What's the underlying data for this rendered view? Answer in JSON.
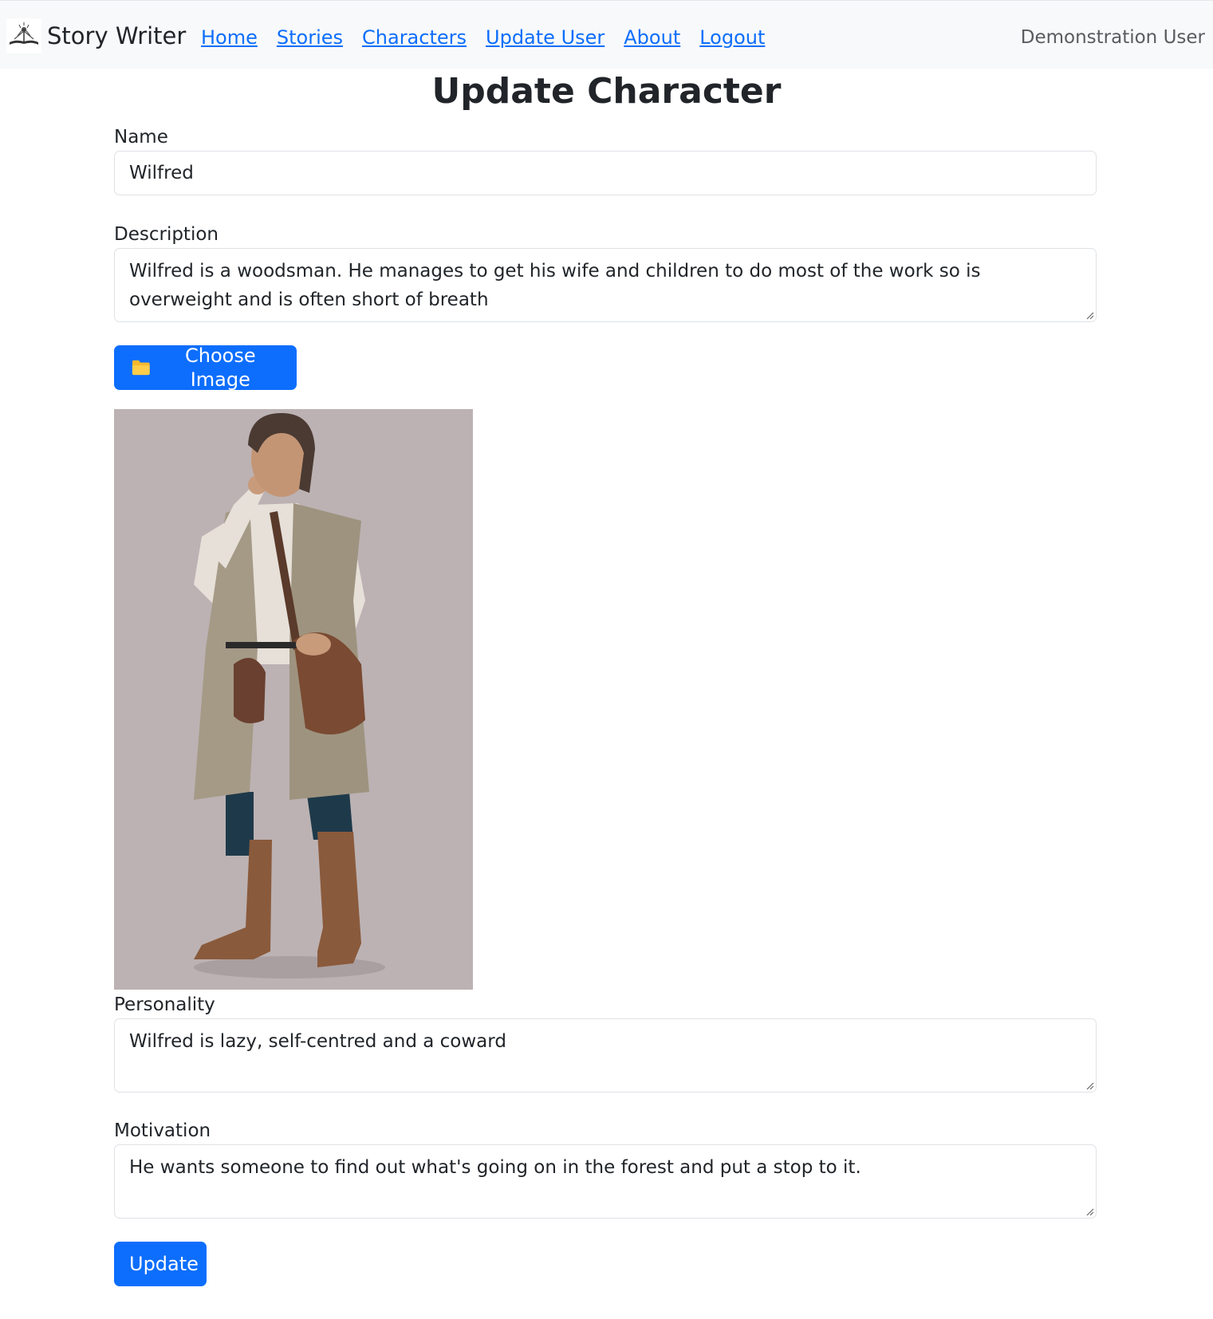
{
  "nav": {
    "brand": "Story Writer",
    "links": [
      "Home",
      "Stories",
      "Characters",
      "Update User",
      "About",
      "Logout"
    ],
    "user": "Demonstration User"
  },
  "page": {
    "title": "Update Character"
  },
  "form": {
    "name_label": "Name",
    "name_value": "Wilfred",
    "description_label": "Description",
    "description_value": "Wilfred is a woodsman. He manages to get his wife and children to do most of the work so is overweight and is often short of breath",
    "choose_image_label": "Choose Image",
    "choose_image_icon": "folder-icon",
    "personality_label": "Personality",
    "personality_value": "Wilfred is lazy, self-centred and a coward",
    "motivation_label": "Motivation",
    "motivation_value": "He wants someone to find out what's going on in the forest and put a stop to it.",
    "update_label": "Update"
  },
  "colors": {
    "primary": "#0d6efd",
    "navbar_bg": "#f8f9fa",
    "image_bg": "#bcb2b3"
  }
}
